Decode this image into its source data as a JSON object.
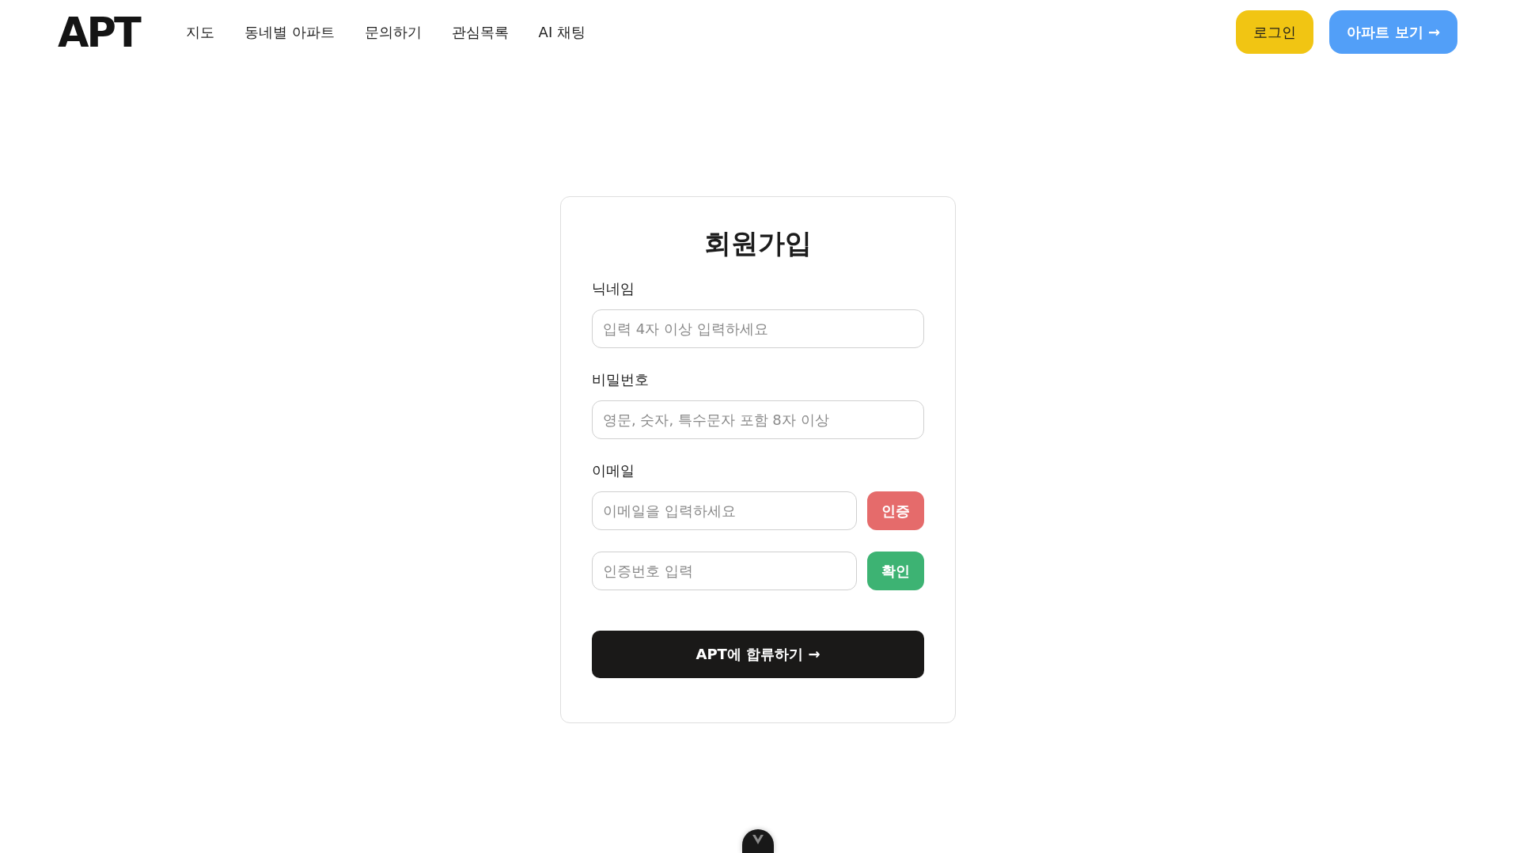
{
  "header": {
    "logo": "APT",
    "nav": [
      {
        "label": "지도"
      },
      {
        "label": "동네별 아파트"
      },
      {
        "label": "문의하기"
      },
      {
        "label": "관심목록"
      },
      {
        "label": "AI 채팅"
      }
    ],
    "buttons": [
      {
        "label": "로그인",
        "kind": "login"
      },
      {
        "label": "아파트 보기 →",
        "kind": "primary"
      }
    ]
  },
  "signup_form": {
    "title": "회원가입",
    "fields": [
      {
        "label": "닉네임",
        "placeholder": "입력 4자 이상 입력하세요"
      },
      {
        "label": "비밀번호",
        "placeholder": "영문, 숫자, 특수문자 포함 8자 이상"
      },
      {
        "label": "이메일",
        "placeholder": "이메일을 입력하세요",
        "button": {
          "label": "인증",
          "kind": "verify"
        }
      },
      {
        "placeholder": "인증번호 입력",
        "button": {
          "label": "확인",
          "kind": "confirm"
        }
      }
    ],
    "submit": "APT에 합류하기 →"
  }
}
